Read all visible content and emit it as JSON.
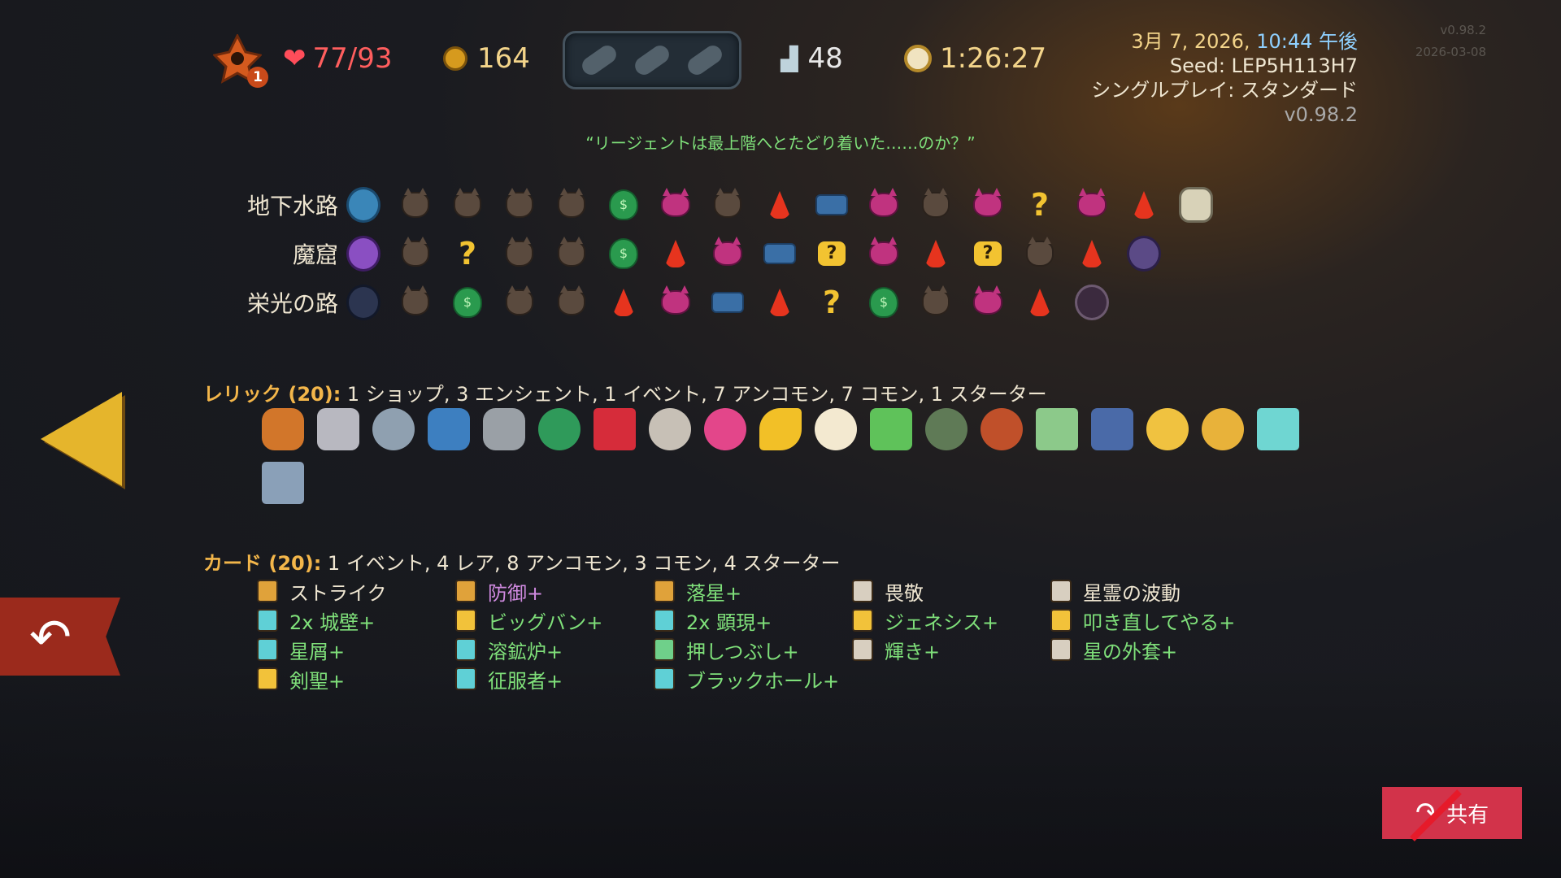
{
  "header": {
    "ascension": "1",
    "hp": "77/93",
    "gold": "164",
    "floor": "48",
    "time": "1:26:27",
    "date": "3月 7, 2026,",
    "clock": "10:44 午後",
    "seed_label": "Seed: LEP5H113H7",
    "mode": "シングルプレイ: スタンダード",
    "version": "v0.98.2",
    "ghost_version": "v0.98.2",
    "ghost_date": "2026-03-08"
  },
  "quote": "“リージェントは最上階へとたどり着いた……のか？”",
  "acts": [
    {
      "name": "地下水路"
    },
    {
      "name": "魔窟"
    },
    {
      "name": "栄光の路"
    }
  ],
  "relics": {
    "title": "レリック (20):",
    "summary": " 1 ショップ,  3 エンシェント, 1 イベント, 7 アンコモン, 7 コモン, 1 スターター"
  },
  "cards": {
    "title": "カード (20):",
    "summary": " 1 イベント, 4 レア, 8 アンコモン, 3 コモン, 4 スターター",
    "items": [
      {
        "label": "ストライク",
        "upgraded": false
      },
      {
        "label": "防御+",
        "upgraded": true
      },
      {
        "label": "落星+",
        "upgraded": true
      },
      {
        "label": "畏敬",
        "upgraded": false
      },
      {
        "label": "星霊の波動",
        "upgraded": false
      },
      {
        "label": "2x 城壁+",
        "upgraded": true
      },
      {
        "label": "ビッグバン+",
        "upgraded": true
      },
      {
        "label": "2x 顕現+",
        "upgraded": true
      },
      {
        "label": "ジェネシス+",
        "upgraded": true
      },
      {
        "label": "叩き直してやる+",
        "upgraded": true
      },
      {
        "label": "星屑+",
        "upgraded": true
      },
      {
        "label": "溶鉱炉+",
        "upgraded": true
      },
      {
        "label": "押しつぶし+",
        "upgraded": true
      },
      {
        "label": "輝き+",
        "upgraded": true
      },
      {
        "label": "星の外套+",
        "upgraded": true
      },
      {
        "label": "剣聖+",
        "upgraded": true
      },
      {
        "label": "征服者+",
        "upgraded": true
      },
      {
        "label": "ブラックホール+",
        "upgraded": true
      }
    ]
  },
  "share_label": "共有",
  "colors": {
    "accent": "#f3b64a",
    "upgrade": "#7fe07a",
    "hp": "#ff5e5e"
  }
}
